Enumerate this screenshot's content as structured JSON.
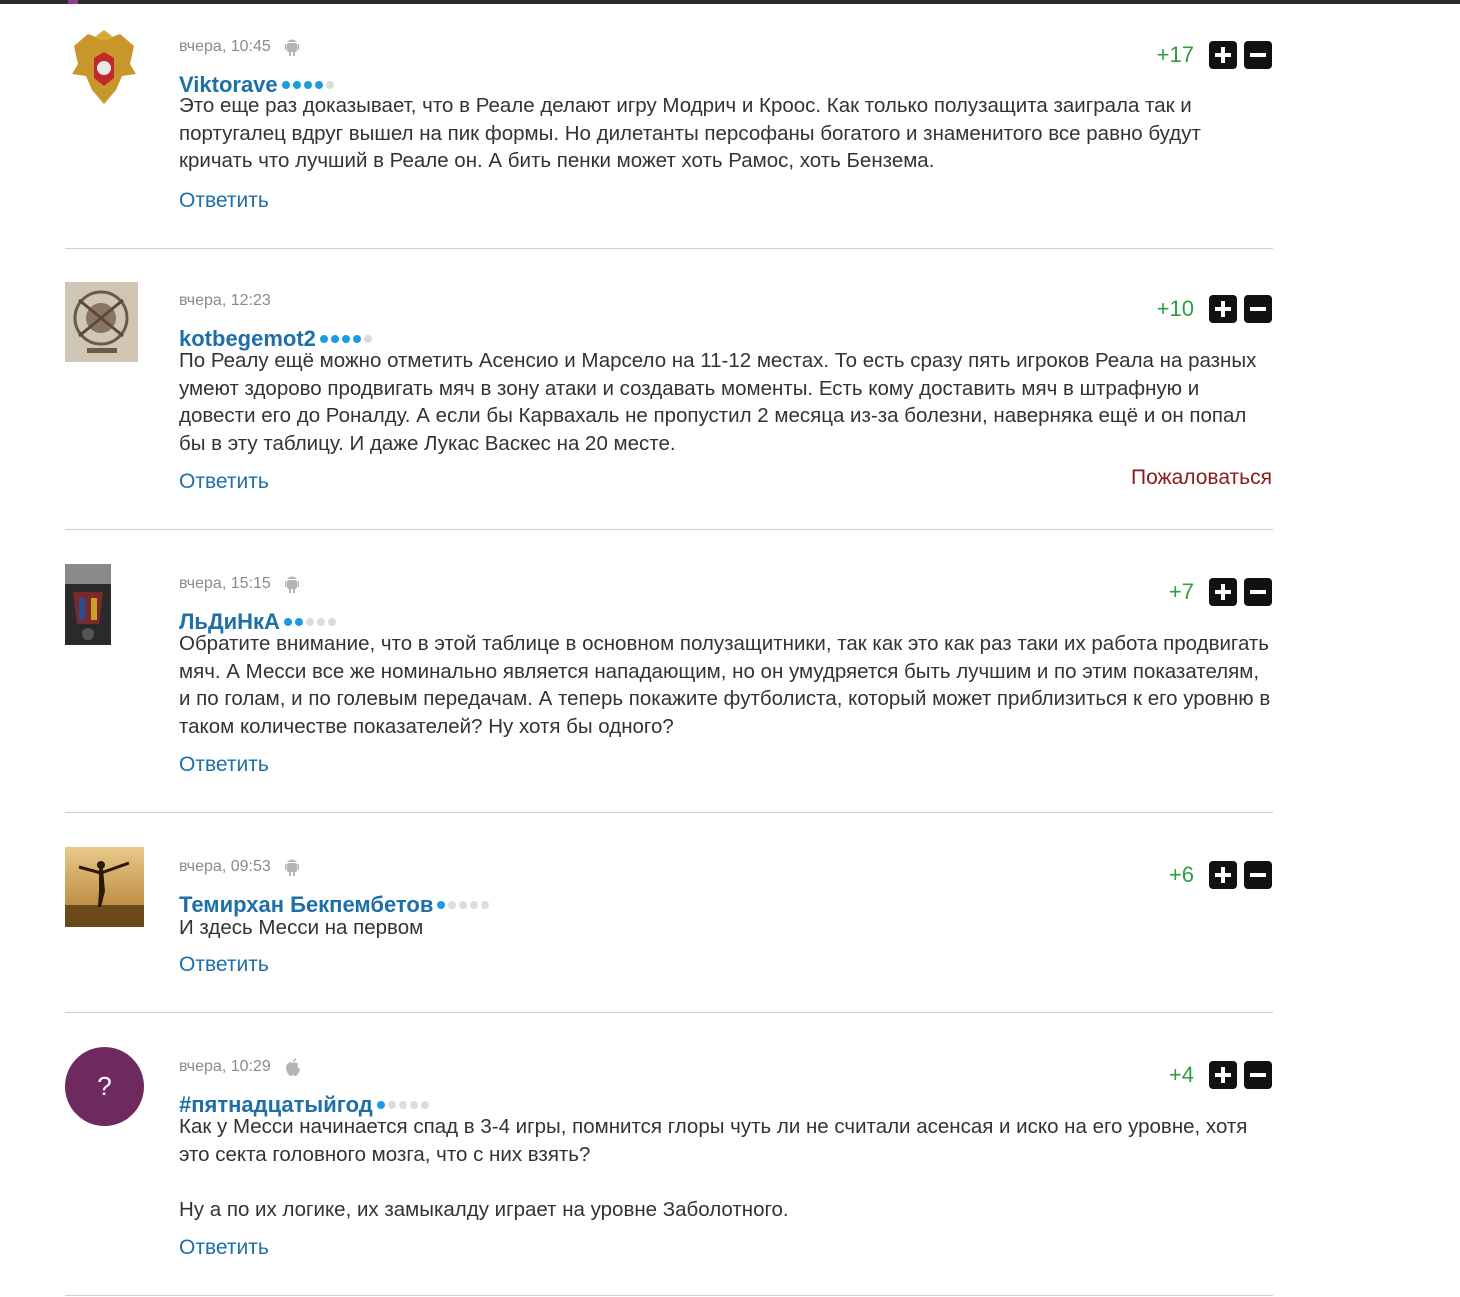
{
  "comments": [
    {
      "time": "вчера, 10:45",
      "device": "android-icon",
      "author": "Viktorave",
      "rating_filled": 4,
      "score": "+17",
      "text": [
        "Это еще раз доказывает, что в Реале делают игру Модрич и Кроос. Как только полузащита заиграла так и португалец вдруг вышел на пик формы. Но дилетанты персофаны богатого и знаменитого все равно будут кричать что лучший в Реале он. А бить пенки может хоть Рамос, хоть Бензема."
      ],
      "reply": "Ответить"
    },
    {
      "time": "вчера, 12:23",
      "author": "kotbegemot2",
      "rating_filled": 4,
      "score": "+10",
      "text": [
        "По Реалу ещё можно отметить Асенсио и Марсело на 11-12 местах. То есть сразу пять игроков Реала на разных умеют здорово продвигать мяч в зону атаки и создавать моменты. Есть кому доставить мяч в штрафную и довести его до Роналду. А если бы Карвахаль не пропустил 2 месяца из-за болезни, наверняка ещё и он попал бы в эту таблицу. И даже Лукас Васкес на 20 месте."
      ],
      "reply": "Ответить",
      "complain": "Пожаловаться"
    },
    {
      "time": "вчера, 15:15",
      "device": "android-icon",
      "author": "ЛьДиНкА",
      "rating_filled": 2,
      "score": "+7",
      "text": [
        "Обратите внимание, что в этой таблице в основном полузащитники, так как это как раз таки их работа продвигать мяч. А Месси все же номинально является нападающим, но он умудряется быть лучшим и по этим показателям, и по голам, и по голевым передачам. А теперь покажите футболиста, который может приблизиться к его уровню в таком количестве показателей? Ну хотя бы одного?"
      ],
      "reply": "Ответить"
    },
    {
      "time": "вчера, 09:53",
      "device": "android-icon",
      "author": "Темирхан Бекпембетов",
      "rating_filled": 1,
      "score": "+6",
      "text": [
        "И здесь Месси на первом"
      ],
      "reply": "Ответить"
    },
    {
      "time": "вчера, 10:29",
      "device": "apple-icon",
      "author": "#пятнадцатыйгод",
      "rating_filled": 1,
      "score": "+4",
      "avatar_letter": "?",
      "text": [
        "Как у Месси начинается спад в 3-4 игры, помнится глоры чуть ли не считали асенсая и иско на его уровне, хотя это секта головного мозга, что с них взять?",
        "Ну а по их логике, их замыкалду играет на уровне Заболотного."
      ],
      "reply": "Ответить"
    }
  ],
  "colors": {
    "link": "#1e6fa8",
    "score": "#2e9e3e",
    "complain": "#8b1a1a",
    "avatar_purple": "#6e2a5e",
    "dot_on": "#1a9ce0",
    "dot_off": "#dcdcdc"
  }
}
